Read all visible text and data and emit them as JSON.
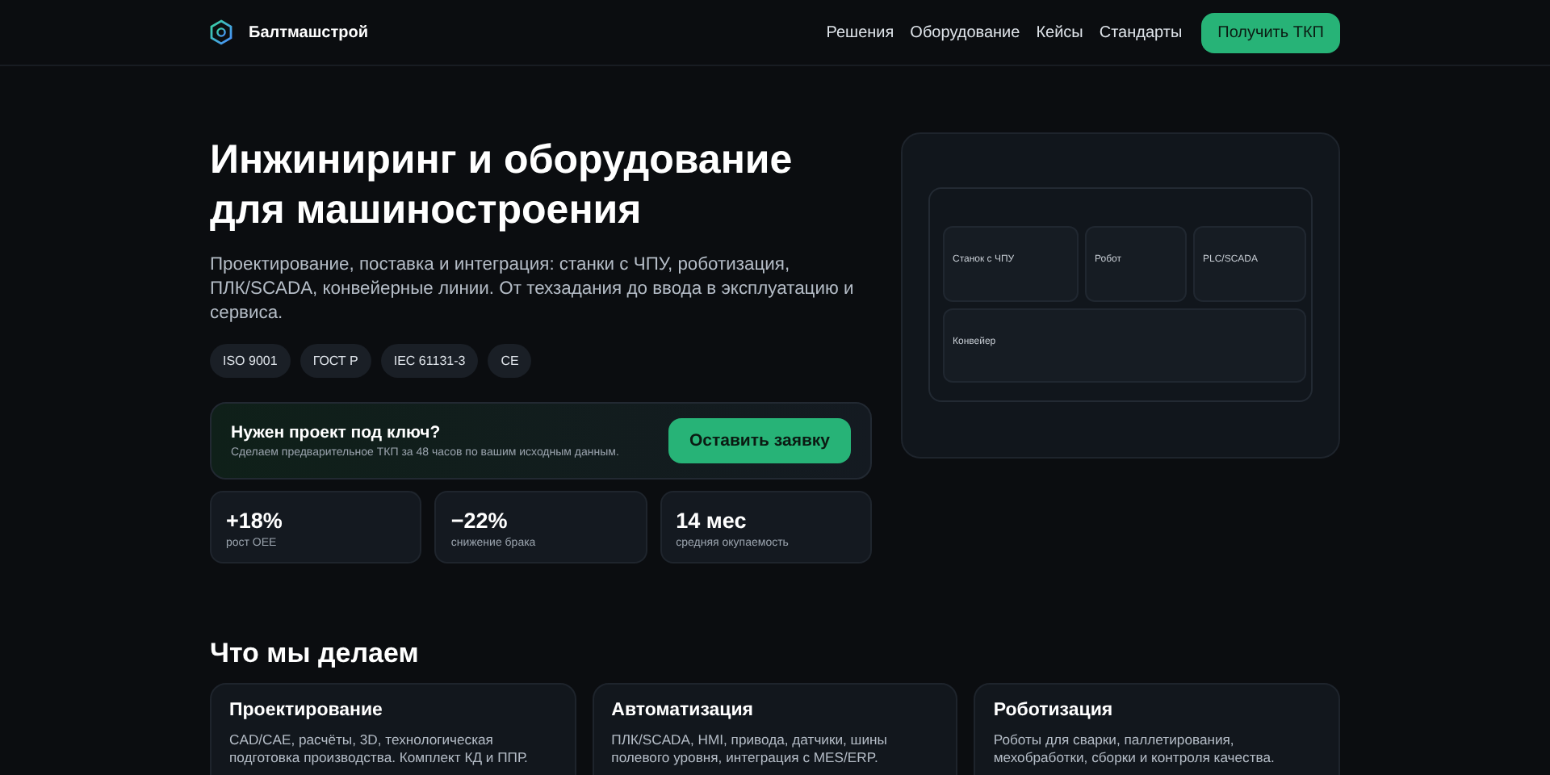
{
  "header": {
    "brand": "Балтмашстрой",
    "nav": [
      {
        "label": "Решения"
      },
      {
        "label": "Оборудование"
      },
      {
        "label": "Кейсы"
      },
      {
        "label": "Стандарты"
      }
    ],
    "cta": "Получить ТКП"
  },
  "hero": {
    "title_lines": [
      "Инжиниринг и оборудование",
      "для машиностроения"
    ],
    "lead": "Проектирование, поставка и интеграция: станки с ЧПУ, роботизация, ПЛК/SCADA, конвейерные линии. От техзадания до ввода в эксплуатацию и сервиса.",
    "badges": [
      "ISO 9001",
      "ГОСТ Р",
      "IEC 61131-3",
      "CE"
    ],
    "callout": {
      "title": "Нужен проект под ключ?",
      "text": "Сделаем предварительное ТКП за 48 часов по вашим исходным данным.",
      "button": "Оставить заявку"
    },
    "stats": [
      {
        "value": "+18%",
        "label": "рост OEE"
      },
      {
        "value": "−22%",
        "label": "снижение брака"
      },
      {
        "value": "14 мес",
        "label": "средняя окупаемость"
      }
    ]
  },
  "diagram": {
    "blocks": [
      {
        "label": "Станок с ЧПУ"
      },
      {
        "label": "Робот"
      },
      {
        "label": "PLC/SCADA"
      },
      {
        "label": "Конвейер"
      }
    ]
  },
  "services": {
    "title": "Что мы делаем",
    "cards": [
      {
        "title": "Проектирование",
        "text": "CAD/CAE, расчёты, 3D, технологическая подготовка производства. Комплект КД и ППР."
      },
      {
        "title": "Автоматизация",
        "text": "ПЛК/SCADA, HMI, привода, датчики, шины полевого уровня, интеграция с MES/ERP."
      },
      {
        "title": "Роботизация",
        "text": "Роботы для сварки, паллетирования, мехобработки, сборки и контроля качества."
      }
    ]
  }
}
